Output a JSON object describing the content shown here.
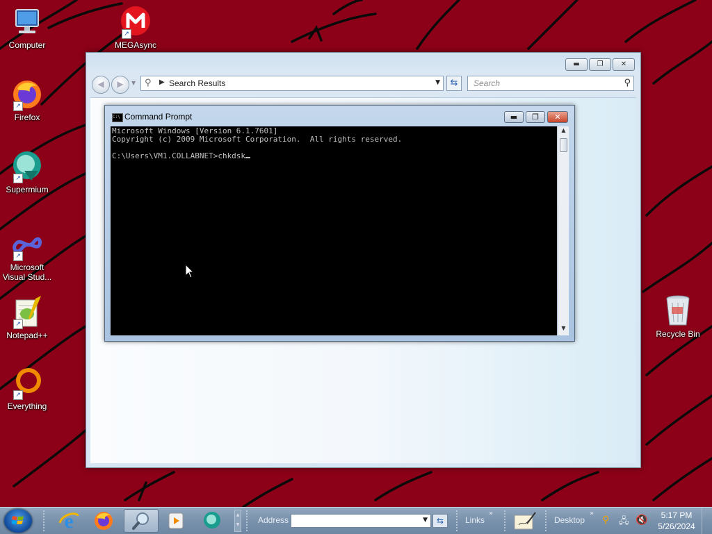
{
  "desktop": {
    "icons_left": [
      {
        "label": "Computer",
        "icon": "computer-icon"
      },
      {
        "label": "Firefox",
        "icon": "firefox-icon"
      },
      {
        "label": "Supermium",
        "icon": "supermium-icon"
      },
      {
        "label": "Microsoft Visual Stud...",
        "icon": "visual-studio-icon"
      },
      {
        "label": "Notepad++",
        "icon": "notepadpp-icon"
      },
      {
        "label": "Everything",
        "icon": "everything-icon"
      }
    ],
    "mega": {
      "label": "MEGAsync",
      "icon": "megasync-icon"
    },
    "recycle": {
      "label": "Recycle Bin",
      "icon": "recycle-bin-icon"
    }
  },
  "explorer": {
    "address": "Search Results",
    "search_placeholder": "Search"
  },
  "cmd": {
    "title": "Command Prompt",
    "lines": [
      "Microsoft Windows [Version 6.1.7601]",
      "Copyright (c) 2009 Microsoft Corporation.  All rights reserved.",
      "",
      "C:\\Users\\VM1.COLLABNET>chkdsk"
    ]
  },
  "taskbar": {
    "pinned": [
      {
        "name": "internet-explorer-icon"
      },
      {
        "name": "firefox-icon"
      },
      {
        "name": "search-icon",
        "active": true
      },
      {
        "name": "media-player-icon"
      },
      {
        "name": "supermium-icon"
      }
    ],
    "address_label": "Address",
    "address_value": "",
    "links_label": "Links",
    "desktop_label": "Desktop",
    "clock_time": "5:17 PM",
    "clock_date": "5/26/2024"
  },
  "colors": {
    "wallpaper": "#8c0018",
    "console_bg": "#000000",
    "console_text": "#c0c0c0"
  }
}
